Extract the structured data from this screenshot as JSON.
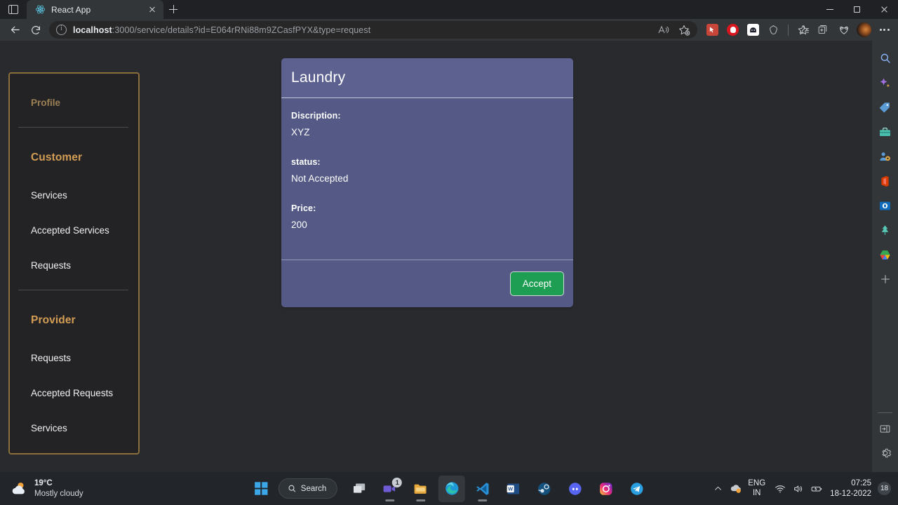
{
  "browser": {
    "tab": {
      "title": "React App",
      "favicon": "react-logo-icon",
      "close_label": "×"
    },
    "newtab_label": "+",
    "url": {
      "host": "localhost",
      "rest": ":3000/service/details?id=E064rRNi88m9ZCasfPYX&type=request"
    },
    "window_controls": {
      "minimize": "minimize",
      "maximize": "maximize",
      "close": "close"
    },
    "nav": {
      "back": "back-icon",
      "refresh": "refresh-icon"
    },
    "toolbar_icons": [
      "read-aloud-icon",
      "add-favorite-icon",
      "extension-red-icon",
      "extension-record-icon",
      "extension-dark-icon",
      "browser-essentials-icon",
      "favorites-icon",
      "collections-icon",
      "extension-heart-icon",
      "profile-avatar",
      "settings-more-icon"
    ],
    "sidebar_icons": [
      "search-icon",
      "copilot-sparkle-icon",
      "shopping-tag-icon",
      "tools-toolbox-icon",
      "games-icon",
      "office-icon",
      "outlook-icon",
      "tree-icon",
      "drive-icon",
      "add-icon"
    ],
    "sidebar_bottom_icons": [
      "expand-panel-icon",
      "gear-icon"
    ]
  },
  "menu": {
    "profile": "Profile",
    "sections": [
      {
        "heading": "Customer",
        "items": [
          "Services",
          "Accepted Services",
          "Requests"
        ]
      },
      {
        "heading": "Provider",
        "items": [
          "Requests",
          "Accepted Requests",
          "Services"
        ]
      }
    ]
  },
  "card": {
    "title": "Laundry",
    "fields": [
      {
        "label": "Discription:",
        "value": "XYZ"
      },
      {
        "label": "status:",
        "value": "Not Accepted"
      },
      {
        "label": "Price:",
        "value": "200"
      }
    ],
    "accept_label": "Accept"
  },
  "taskbar": {
    "weather": {
      "temp": "19°C",
      "desc": "Mostly cloudy",
      "icon": "partly-cloudy-icon"
    },
    "search_placeholder": "Search",
    "apps": [
      "start-icon",
      "task-view-icon",
      "teams-icon",
      "file-explorer-icon",
      "edge-icon",
      "vscode-icon",
      "word-icon",
      "steam-icon",
      "discord-icon",
      "instagram-icon",
      "telegram-icon"
    ],
    "teams_badge": "1",
    "tray": {
      "overflow": "show-hidden-icons",
      "onedrive": "onedrive-sync-icon",
      "lang_top": "ENG",
      "lang_bottom": "IN",
      "wifi": "wifi-icon",
      "volume": "volume-icon",
      "battery": "battery-icon",
      "time": "07:25",
      "date": "18-12-2022",
      "notifications": "18"
    }
  },
  "colors": {
    "page_bg": "#282a2e",
    "menu_border": "#8a6e3c",
    "menu_heading": "#d49e54",
    "card_header": "#5c6190",
    "card_body": "#545a85",
    "accept_green": "#1e9e53"
  }
}
